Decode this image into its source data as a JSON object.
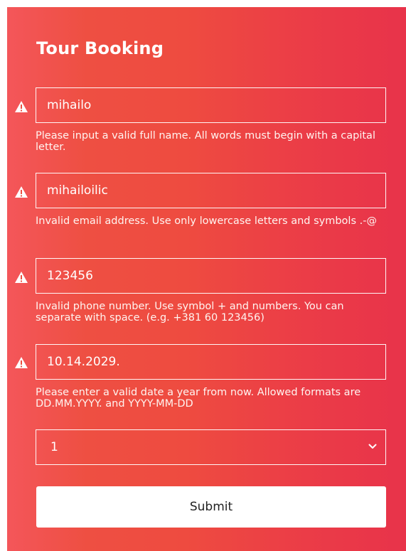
{
  "form": {
    "title": "Tour Booking",
    "fields": [
      {
        "name": "full-name",
        "value": "mihailo",
        "error": "Please input a valid full name. All words must begin with a capital letter."
      },
      {
        "name": "email",
        "value": "mihailoilic",
        "error": "Invalid email address. Use only lowercase letters and symbols .-@"
      },
      {
        "name": "phone",
        "value": "123456",
        "error": "Invalid phone number. Use symbol + and numbers. You can separate with space. (e.g. +381 60 123456)"
      },
      {
        "name": "date",
        "value": "10.14.2029.",
        "error": "Please enter a valid date a year from now. Allowed formats are DD.MM.YYYY. and YYYY-MM-DD"
      }
    ],
    "select": {
      "value": "1"
    },
    "submit_label": "Submit"
  },
  "icons": {
    "warning": "warning-icon",
    "chevron": "chevron-down-icon"
  },
  "colors": {
    "gradient_start": "#f4565a",
    "gradient_end": "#e8334a",
    "text": "#ffffff",
    "button_bg": "#ffffff"
  }
}
